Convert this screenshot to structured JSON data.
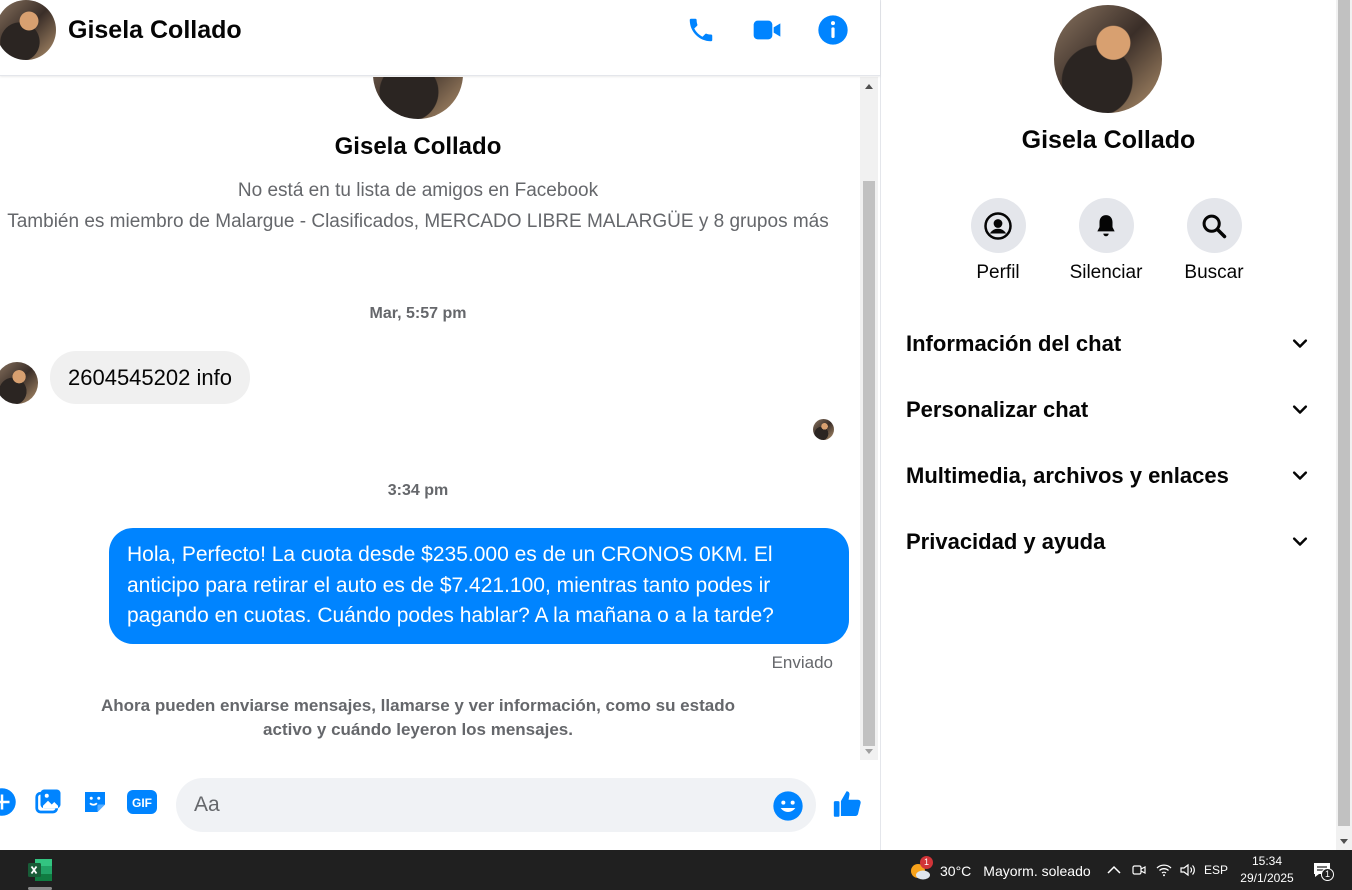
{
  "header": {
    "contact_name": "Gisela Collado",
    "phone_icon": "phone-icon",
    "video_icon": "video-camera-icon",
    "info_icon": "info-icon"
  },
  "intro": {
    "name": "Gisela Collado",
    "friend_status": "No está en tu lista de amigos en Facebook",
    "groups": "También es miembro de Malargue - Clasificados, MERCADO LIBRE MALARGÜE y 8 grupos más"
  },
  "messages": [
    {
      "type": "timestamp",
      "text": "Mar, 5:57 pm"
    },
    {
      "type": "incoming",
      "text": "2604545202 info"
    },
    {
      "type": "timestamp",
      "text": "3:34 pm"
    },
    {
      "type": "outgoing",
      "text": "Hola, Perfecto! La cuota desde $235.000 es de un CRONOS 0KM. El anticipo para retirar el auto es de $7.421.100, mientras tanto podes ir pagando en cuotas. Cuándo podes hablar? A la mañana o a la tarde?",
      "status": "Enviado"
    }
  ],
  "notice": "Ahora pueden enviarse mensajes, llamarse y ver información, como su estado activo y cuándo leyeron los mensajes.",
  "composer": {
    "placeholder": "Aa",
    "icons": [
      "plus-circle-icon",
      "image-icon",
      "sticker-icon",
      "gif-icon",
      "emoji-icon",
      "thumbs-up-icon"
    ],
    "gif_label": "GIF"
  },
  "panel": {
    "name": "Gisela Collado",
    "actions": [
      {
        "label": "Perfil",
        "icon": "profile-icon"
      },
      {
        "label": "Silenciar",
        "icon": "bell-icon"
      },
      {
        "label": "Buscar",
        "icon": "search-icon"
      }
    ],
    "sections": [
      {
        "label": "Información del chat"
      },
      {
        "label": "Personalizar chat"
      },
      {
        "label": "Multimedia, archivos y enlaces"
      },
      {
        "label": "Privacidad y ayuda"
      }
    ]
  },
  "taskbar": {
    "app_icon": "excel-icon",
    "weather_badge": "1",
    "weather_temp": "30°C",
    "weather_desc": "Mayorm. soleado",
    "language": "ESP",
    "time": "15:34",
    "date": "29/1/2025",
    "notification_count": "1"
  },
  "colors": {
    "accent": "#0084ff",
    "incoming_bubble": "#f0f0f0",
    "muted_text": "#65676b",
    "taskbar": "#202020"
  }
}
